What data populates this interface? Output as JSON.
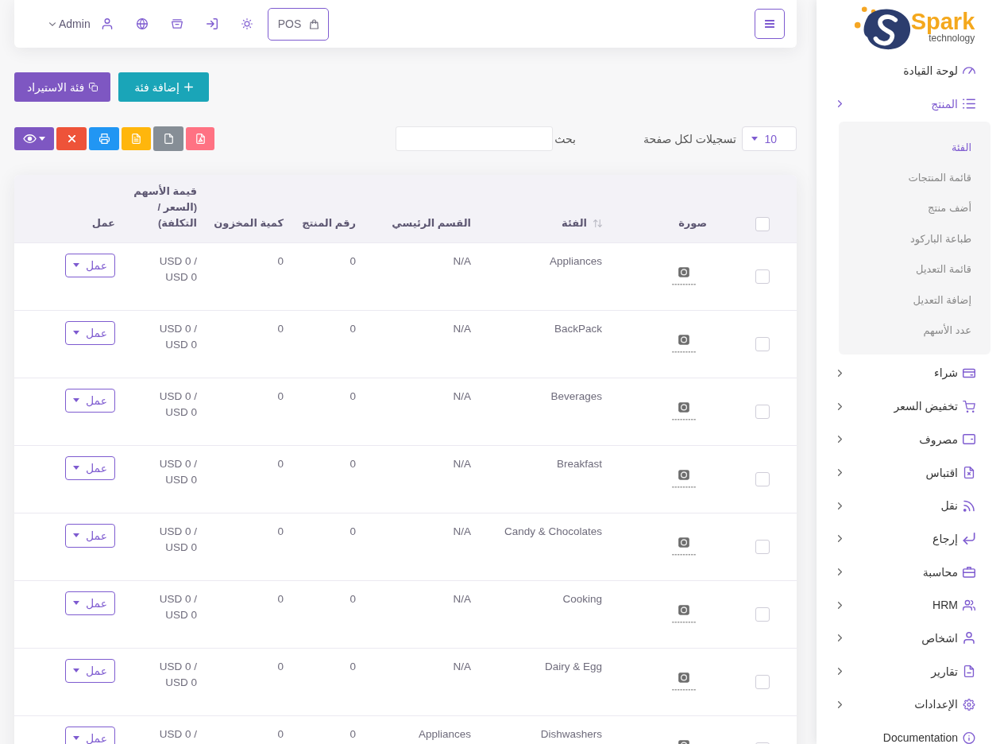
{
  "sidebar": {
    "logo": {
      "title": "Spark",
      "subtitle": "technology"
    },
    "items": [
      {
        "label": "لوحة القيادة",
        "kind": "link",
        "selected": false
      },
      {
        "label": "المنتج",
        "kind": "menu",
        "selected": true,
        "expanded": true,
        "children": [
          {
            "label": "الفئة",
            "selected": true
          },
          {
            "label": "قائمة المنتجات",
            "selected": false
          },
          {
            "label": "أضف منتج",
            "selected": false
          },
          {
            "label": "طباعة الباركود",
            "selected": false
          },
          {
            "label": "قائمة التعديل",
            "selected": false
          },
          {
            "label": "إضافة التعديل",
            "selected": false
          },
          {
            "label": "عدد الأسهم",
            "selected": false
          }
        ]
      },
      {
        "label": "شراء",
        "kind": "menu",
        "selected": false,
        "expanded": false
      },
      {
        "label": "تخفيض السعر",
        "kind": "menu",
        "selected": false,
        "expanded": false
      },
      {
        "label": "مصروف",
        "kind": "menu",
        "selected": false,
        "expanded": false
      },
      {
        "label": "اقتباس",
        "kind": "menu",
        "selected": false,
        "expanded": false
      },
      {
        "label": "نقل",
        "kind": "menu",
        "selected": false,
        "expanded": false
      },
      {
        "label": "إرجاع",
        "kind": "menu",
        "selected": false,
        "expanded": false
      },
      {
        "label": "محاسبة",
        "kind": "menu",
        "selected": false,
        "expanded": false
      },
      {
        "label": "HRM",
        "kind": "menu",
        "selected": false,
        "expanded": false
      },
      {
        "label": "اشخاص",
        "kind": "menu",
        "selected": false,
        "expanded": false
      },
      {
        "label": "تقارير",
        "kind": "menu",
        "selected": false,
        "expanded": false
      },
      {
        "label": "الإعدادات",
        "kind": "menu",
        "selected": false,
        "expanded": false
      },
      {
        "label": "Documentation",
        "kind": "link",
        "selected": false
      }
    ]
  },
  "topbar": {
    "pos_button": {
      "label": "POS"
    },
    "user_menu": {
      "label": "Admin"
    }
  },
  "actions": [
    {
      "label": "إضافة فئة",
      "kind": "add"
    },
    {
      "label": "فئة الاستيراد",
      "kind": "import"
    }
  ],
  "table_controls": {
    "per_page": {
      "value": "10",
      "label": "تسجيلات لكل صفحة"
    },
    "search": {
      "label": "بحث"
    }
  },
  "table": {
    "select_all": {
      "checked": false
    },
    "columns": [
      {
        "label": "صورة",
        "sortable": false
      },
      {
        "label": "الفئة",
        "sortable": true
      },
      {
        "label": "القسم الرئيسي",
        "sortable": false
      },
      {
        "label": "رقم المنتج",
        "sortable": false
      },
      {
        "label": "كمية المخزون",
        "sortable": false
      },
      {
        "label": "قيمة الأسهم (السعر / التكلفة)",
        "sortable": false
      },
      {
        "label": "عمل",
        "sortable": false
      }
    ],
    "rows": [
      {
        "checked": false,
        "category": "Appliances",
        "main_category": "N/A",
        "product_number": "0",
        "stock_quantity": "0",
        "stock_value": "USD 0 / USD 0",
        "action": "عمل"
      },
      {
        "checked": false,
        "category": "BackPack",
        "main_category": "N/A",
        "product_number": "0",
        "stock_quantity": "0",
        "stock_value": "USD 0 / USD 0",
        "action": "عمل"
      },
      {
        "checked": false,
        "category": "Beverages",
        "main_category": "N/A",
        "product_number": "0",
        "stock_quantity": "0",
        "stock_value": "USD 0 / USD 0",
        "action": "عمل"
      },
      {
        "checked": false,
        "category": "Breakfast",
        "main_category": "N/A",
        "product_number": "0",
        "stock_quantity": "0",
        "stock_value": "USD 0 / USD 0",
        "action": "عمل"
      },
      {
        "checked": false,
        "category": "Candy & Chocolates",
        "main_category": "N/A",
        "product_number": "0",
        "stock_quantity": "0",
        "stock_value": "USD 0 / USD 0",
        "action": "عمل"
      },
      {
        "checked": false,
        "category": "Cooking",
        "main_category": "N/A",
        "product_number": "0",
        "stock_quantity": "0",
        "stock_value": "USD 0 / USD 0",
        "action": "عمل"
      },
      {
        "checked": false,
        "category": "Dairy & Egg",
        "main_category": "N/A",
        "product_number": "0",
        "stock_quantity": "0",
        "stock_value": "USD 0 / USD 0",
        "action": "عمل"
      },
      {
        "checked": false,
        "category": "Dishwashers",
        "main_category": "Appliances",
        "product_number": "0",
        "stock_quantity": "0",
        "stock_value": "USD 0 /",
        "action": "عمل"
      }
    ]
  }
}
